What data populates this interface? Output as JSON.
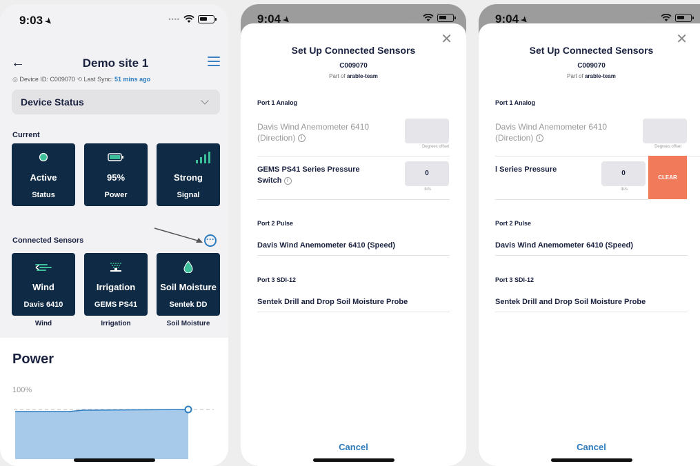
{
  "screen1": {
    "status_time": "9:03",
    "site_title": "Demo site 1",
    "device_id": "Device ID: C009070",
    "last_sync_label": "Last Sync:",
    "last_sync_value": "51 mins ago",
    "status_dropdown": "Device Status",
    "current_heading": "Current",
    "current_tiles": [
      {
        "value": "Active",
        "label": "Status",
        "icon": "status-dot-icon"
      },
      {
        "value": "95%",
        "label": "Power",
        "icon": "battery-icon"
      },
      {
        "value": "Strong",
        "label": "Signal",
        "icon": "signal-bars-icon"
      }
    ],
    "connected_heading": "Connected Sensors",
    "sensor_tiles": [
      {
        "value": "Wind",
        "label": "Davis 6410",
        "caption": "Wind",
        "icon": "wind-icon"
      },
      {
        "value": "Irrigation",
        "label": "GEMS PS41",
        "caption": "Irrigation",
        "icon": "sprinkler-icon"
      },
      {
        "value": "Soil Moisture",
        "label": "Sentek DD",
        "caption": "Soil Moisture",
        "icon": "droplet-icon"
      }
    ],
    "power_title": "Power",
    "power_pct": "100%",
    "colors": {
      "tile_bg": "#0f2a44",
      "accent": "#2b7bbf"
    }
  },
  "screen2": {
    "status_time": "9:04",
    "title": "Set Up Connected Sensors",
    "device": "C009070",
    "part_of_prefix": "Part of",
    "team": "arable-team",
    "port1": "Port 1 Analog",
    "sensor1_line1": "Davis Wind Anemometer 6410",
    "sensor1_line2": "(Direction)",
    "sensor1_unit": "Degrees offset",
    "sensor2_line1": "GEMS PS41 Series Pressure",
    "sensor2_line2": "Switch",
    "sensor2_value": "0",
    "sensor2_unit": "ltr/s",
    "port2": "Port 2 Pulse",
    "sensor3": "Davis Wind Anemometer 6410 (Speed)",
    "port3": "Port 3 SDI-12",
    "sensor4": "Sentek Drill and Drop Soil Moisture Probe",
    "cancel": "Cancel"
  },
  "screen3": {
    "status_time": "9:04",
    "title": "Set Up Connected Sensors",
    "device": "C009070",
    "part_of_prefix": "Part of",
    "team": "arable-team",
    "port1": "Port 1 Analog",
    "sensor1_line1": "Davis Wind Anemometer 6410",
    "sensor1_line2": "(Direction)",
    "sensor1_unit": "Degrees offset",
    "sensor2_partial": "l Series Pressure",
    "sensor2_value": "0",
    "sensor2_unit": "ltr/s",
    "clear": "CLEAR",
    "port2": "Port 2 Pulse",
    "sensor3": "Davis Wind Anemometer 6410 (Speed)",
    "port3": "Port 3 SDI-12",
    "sensor4": "Sentek Drill and Drop Soil Moisture Probe",
    "cancel": "Cancel"
  }
}
